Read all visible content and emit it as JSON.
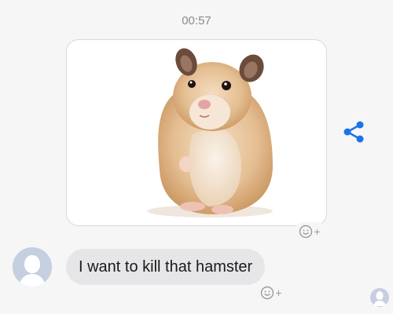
{
  "conversation": {
    "timestamp": "00:57",
    "messages": [
      {
        "type": "image",
        "image_subject": "hamster photo",
        "reaction_control": {
          "icon": "add-reaction-icon",
          "plus": "+"
        }
      },
      {
        "type": "text",
        "text": "I want to kill that hamster",
        "reaction_control": {
          "icon": "add-reaction-icon",
          "plus": "+"
        }
      }
    ],
    "share_icon": "share-icon",
    "colors": {
      "accent": "#1a73e8",
      "bubble": "#e6e6e8",
      "avatar": "#c5cfe0"
    }
  }
}
